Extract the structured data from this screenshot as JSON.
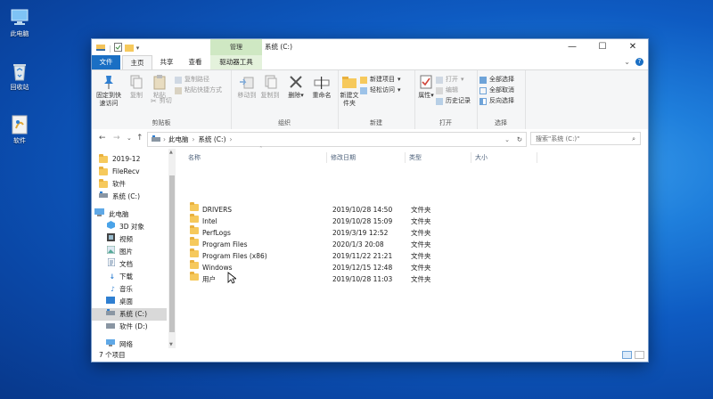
{
  "desktop": {
    "icons": [
      {
        "label": "此电脑"
      },
      {
        "label": "回收站"
      },
      {
        "label": "软件"
      }
    ]
  },
  "window": {
    "title": "系统 (C:)",
    "context_tab_group": "管理",
    "controls": {
      "minimize": "—",
      "maximize": "☐",
      "close": "✕"
    }
  },
  "tabs": [
    {
      "label": "文件"
    },
    {
      "label": "主页"
    },
    {
      "label": "共享"
    },
    {
      "label": "查看"
    },
    {
      "label": "驱动器工具"
    }
  ],
  "ribbon": {
    "clipboard": {
      "group": "剪贴板",
      "pin": "固定到快速访问",
      "copy": "复制",
      "paste": "粘贴",
      "copy_path": "复制路径",
      "paste_shortcut": "粘贴快捷方式",
      "cut": "剪切"
    },
    "organize": {
      "group": "组织",
      "move_to": "移动到",
      "copy_to": "复制到",
      "delete": "删除",
      "rename": "重命名"
    },
    "new": {
      "group": "新建",
      "new_folder": "新建文件夹",
      "new_item": "新建项目",
      "easy_access": "轻松访问"
    },
    "open": {
      "group": "打开",
      "properties": "属性",
      "open": "打开",
      "edit": "编辑",
      "history": "历史记录"
    },
    "select": {
      "group": "选择",
      "select_all": "全部选择",
      "select_none": "全部取消",
      "invert": "反向选择"
    }
  },
  "address": {
    "crumbs": [
      "此电脑",
      "系统 (C:)"
    ],
    "search_placeholder": "搜索\"系统 (C:)\""
  },
  "nav": {
    "items": [
      {
        "label": "2019-12",
        "icon": "folder"
      },
      {
        "label": "FileRecv",
        "icon": "folder"
      },
      {
        "label": "软件",
        "icon": "folder"
      },
      {
        "label": "系统 (C:)",
        "icon": "drive"
      },
      {
        "label": "此电脑",
        "icon": "pc"
      },
      {
        "label": "3D 对象",
        "icon": "3d"
      },
      {
        "label": "视频",
        "icon": "video"
      },
      {
        "label": "图片",
        "icon": "picture"
      },
      {
        "label": "文档",
        "icon": "document"
      },
      {
        "label": "下载",
        "icon": "download"
      },
      {
        "label": "音乐",
        "icon": "music"
      },
      {
        "label": "桌面",
        "icon": "desktop"
      },
      {
        "label": "系统 (C:)",
        "icon": "drive",
        "selected": true
      },
      {
        "label": "软件 (D:)",
        "icon": "drive"
      },
      {
        "label": "网络",
        "icon": "network"
      }
    ]
  },
  "columns": [
    "名称",
    "修改日期",
    "类型",
    "大小"
  ],
  "files": [
    {
      "name": "DRIVERS",
      "date": "2019/10/28 14:50",
      "type": "文件夹"
    },
    {
      "name": "Intel",
      "date": "2019/10/28 15:09",
      "type": "文件夹"
    },
    {
      "name": "PerfLogs",
      "date": "2019/3/19 12:52",
      "type": "文件夹"
    },
    {
      "name": "Program Files",
      "date": "2020/1/3 20:08",
      "type": "文件夹"
    },
    {
      "name": "Program Files (x86)",
      "date": "2019/11/22 21:21",
      "type": "文件夹"
    },
    {
      "name": "Windows",
      "date": "2019/12/15 12:48",
      "type": "文件夹"
    },
    {
      "name": "用户",
      "date": "2019/10/28 11:03",
      "type": "文件夹"
    }
  ],
  "status": {
    "count": "7 个项目"
  },
  "colors": {
    "accent": "#1a6fc4",
    "folder": "#f6c95c",
    "context_tab": "#cfe8c3"
  }
}
